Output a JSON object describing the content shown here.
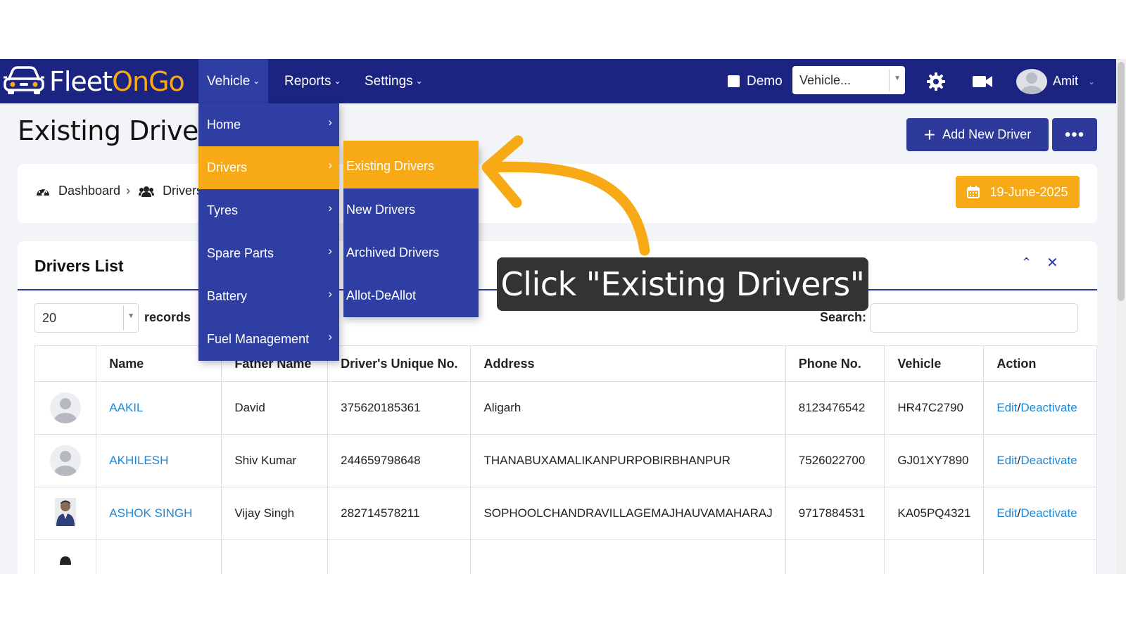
{
  "app": {
    "brand_first": "Fleet",
    "brand_second": "OnGo"
  },
  "nav": {
    "items": [
      {
        "label": "Vehicle"
      },
      {
        "label": "Reports"
      },
      {
        "label": "Settings"
      }
    ],
    "demo_label": "Demo",
    "vehicle_select_value": "Vehicle...",
    "user_name": "Amit"
  },
  "menu": {
    "items": [
      {
        "label": "Home"
      },
      {
        "label": "Drivers"
      },
      {
        "label": "Tyres"
      },
      {
        "label": "Spare Parts"
      },
      {
        "label": "Battery"
      },
      {
        "label": "Fuel Management"
      }
    ],
    "submenu": [
      {
        "label": "Existing Drivers"
      },
      {
        "label": "New Drivers"
      },
      {
        "label": "Archived Drivers"
      },
      {
        "label": "Allot-DeAllot"
      }
    ]
  },
  "page": {
    "title": "Existing Drivers",
    "add_button": "Add New Driver",
    "more_button": "•••",
    "breadcrumb": {
      "dashboard": "Dashboard",
      "current": "Drivers"
    },
    "date": "19-June-2025"
  },
  "list": {
    "title": "Drivers List",
    "records_value": "20",
    "records_label": "records",
    "search_label": "Search:",
    "search_value": "",
    "columns": [
      "",
      "Name",
      "Father Name",
      "Driver's Unique No.",
      "Address",
      "Phone No.",
      "Vehicle",
      "Action"
    ],
    "rows": [
      {
        "name": "AAKIL",
        "father": "David",
        "uid": "375620185361",
        "address": "Aligarh",
        "phone": "8123476542",
        "vehicle": "HR47C2790",
        "edit": "Edit",
        "slash": "/",
        "deactivate": "Deactivate"
      },
      {
        "name": "AKHILESH",
        "father": "Shiv Kumar",
        "uid": "244659798648",
        "address": "THANABUXAMALIKANPURPOBIRBHANPUR",
        "phone": "7526022700",
        "vehicle": "GJ01XY7890",
        "edit": "Edit",
        "slash": "/",
        "deactivate": "Deactivate"
      },
      {
        "name": "ASHOK SINGH",
        "father": "Vijay Singh",
        "uid": "282714578211",
        "address": "SOPHOOLCHANDRAVILLAGEMAJHAUVAMAHARAJ",
        "phone": "9717884531",
        "vehicle": "KA05PQ4321",
        "edit": "Edit",
        "slash": "/",
        "deactivate": "Deactivate"
      }
    ]
  },
  "tutorial": {
    "callout": "Click \"Existing Drivers\"",
    "arrow_color": "#f7a916"
  },
  "colors": {
    "navbar": "#1b2480",
    "menu": "#2e3ea3",
    "accent": "#f7a916",
    "link": "#1e88d6"
  }
}
